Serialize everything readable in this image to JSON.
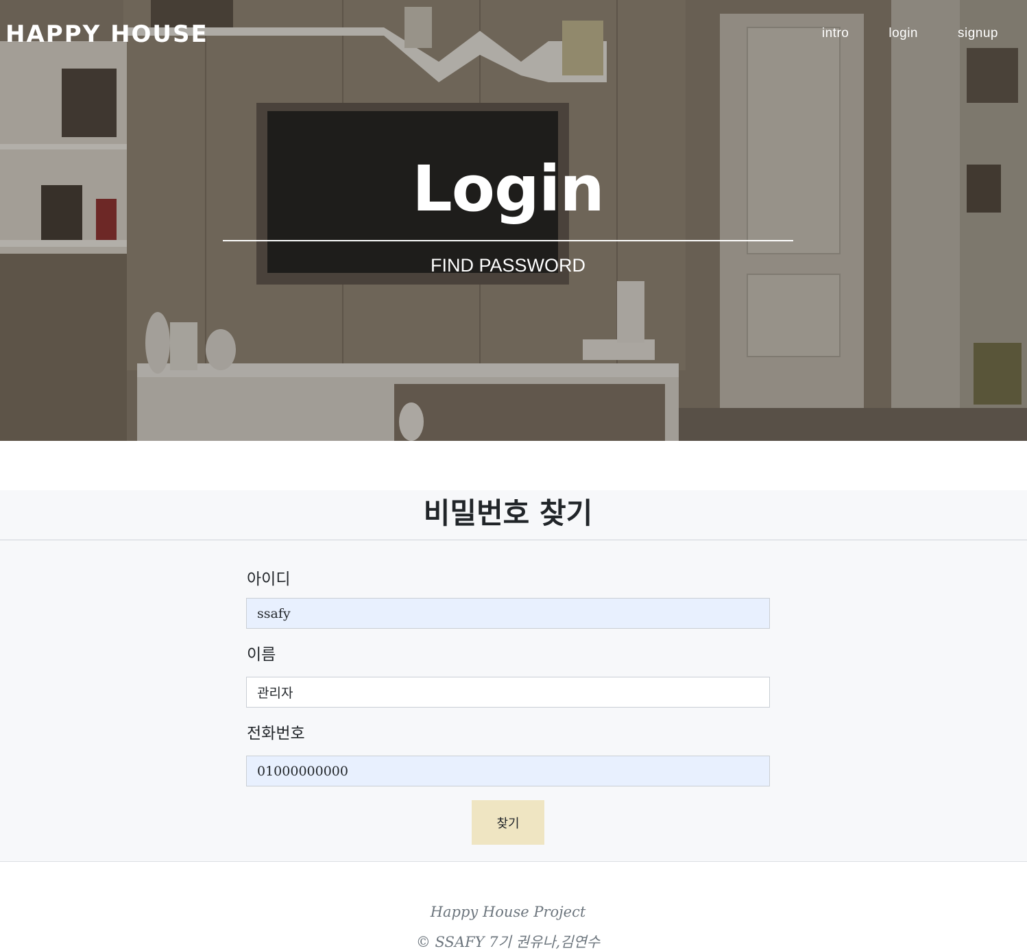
{
  "brand": "HAPPY HOUSE",
  "nav": {
    "items": [
      {
        "label": "intro"
      },
      {
        "label": "login"
      },
      {
        "label": "signup"
      }
    ]
  },
  "hero": {
    "title": "Login",
    "subtitle": "FIND PASSWORD"
  },
  "form": {
    "title": "비밀번호 찾기",
    "fields": [
      {
        "label": "아이디",
        "value": "ssafy"
      },
      {
        "label": "이름",
        "value": "관리자"
      },
      {
        "label": "전화번호",
        "value": "01000000000"
      }
    ],
    "submit_label": "찾기"
  },
  "footer": {
    "line1": "Happy House Project",
    "line2": "© SSAFY 7기 권유나,김연수"
  },
  "colors": {
    "button_bg": "#efe5c2",
    "autofill_bg": "#e8f0fe",
    "section_bg": "#f7f8fa",
    "footer_text": "#6c757d"
  }
}
